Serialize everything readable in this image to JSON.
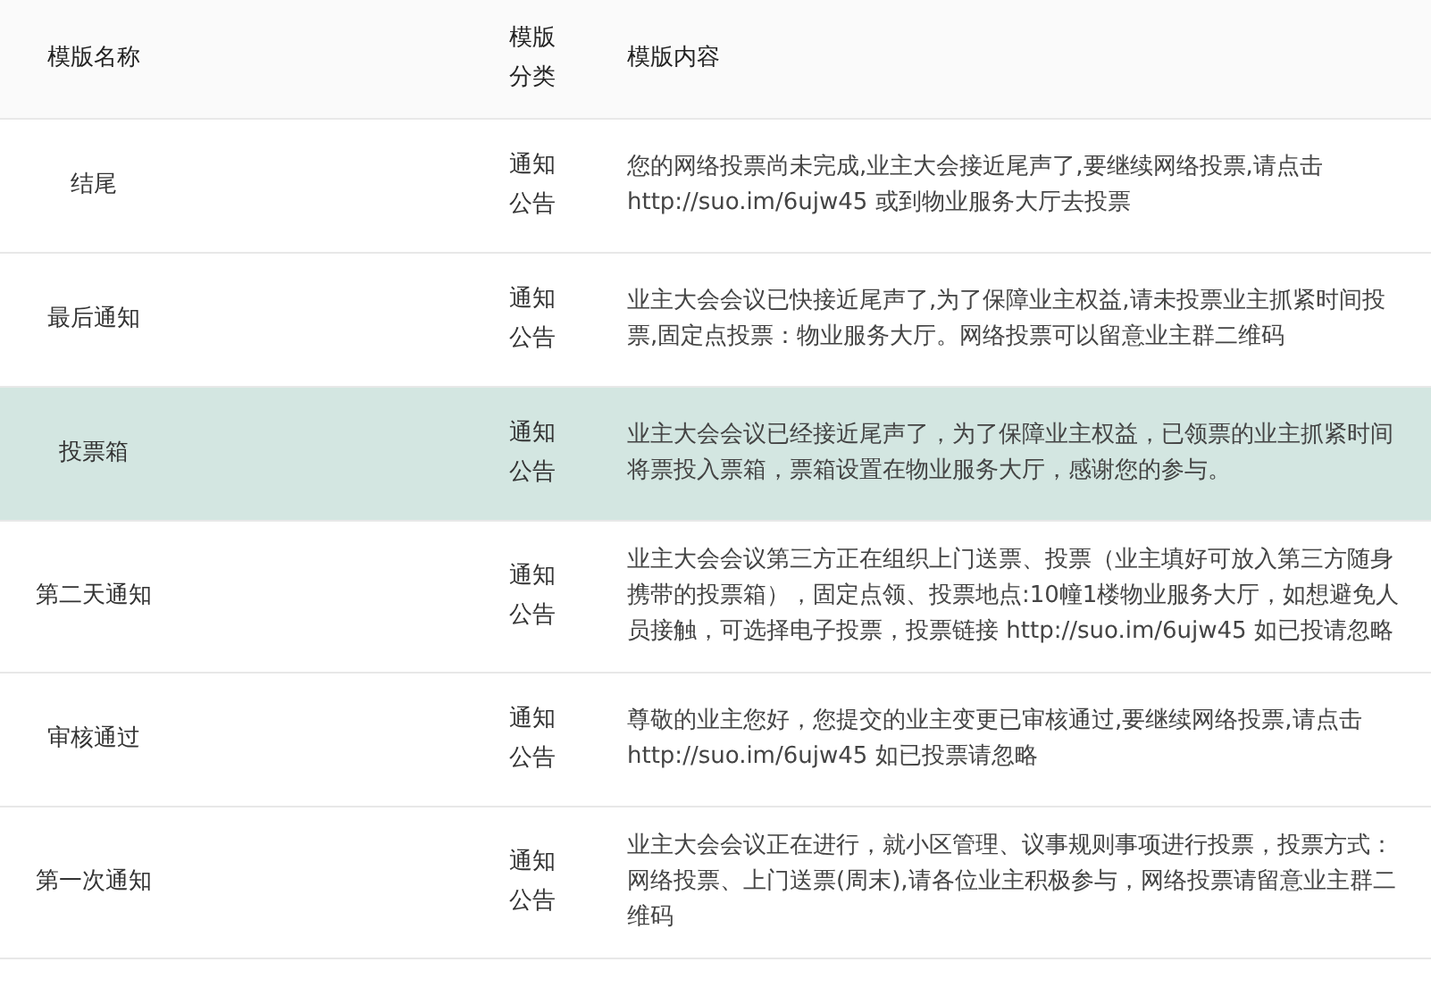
{
  "table": {
    "columns": [
      "模版名称",
      "模版分类",
      "模版内容"
    ],
    "rows": [
      {
        "name": "结尾",
        "category": "通知公告",
        "content": "您的网络投票尚未完成,业主大会接近尾声了,要继续网络投票,请点击 http://suo.im/6ujw45 或到物业服务大厅去投票",
        "selected": false
      },
      {
        "name": "最后通知",
        "category": "通知公告",
        "content": "业主大会会议已快接近尾声了,为了保障业主权益,请未投票业主抓紧时间投票,固定点投票：物业服务大厅。网络投票可以留意业主群二维码",
        "selected": false
      },
      {
        "name": "投票箱",
        "category": "通知公告",
        "content": "业主大会会议已经接近尾声了，为了保障业主权益，已领票的业主抓紧时间将票投入票箱，票箱设置在物业服务大厅，感谢您的参与。",
        "selected": true
      },
      {
        "name": "第二天通知",
        "category": "通知公告",
        "content": "业主大会会议第三方正在组织上门送票、投票（业主填好可放入第三方随身携带的投票箱），固定点领、投票地点:10幢1楼物业服务大厅，如想避免人员接触，可选择电子投票，投票链接 http://suo.im/6ujw45 如已投请忽略",
        "selected": false
      },
      {
        "name": "审核通过",
        "category": "通知公告",
        "content": "尊敬的业主您好，您提交的业主变更已审核通过,要继续网络投票,请点击 http://suo.im/6ujw45 如已投票请忽略",
        "selected": false
      },
      {
        "name": "第一次通知",
        "category": "通知公告",
        "content": "业主大会会议正在进行，就小区管理、议事规则事项进行投票，投票方式：网络投票、上门送票(周末),请各位业主积极参与，网络投票请留意业主群二维码",
        "selected": false
      }
    ]
  }
}
